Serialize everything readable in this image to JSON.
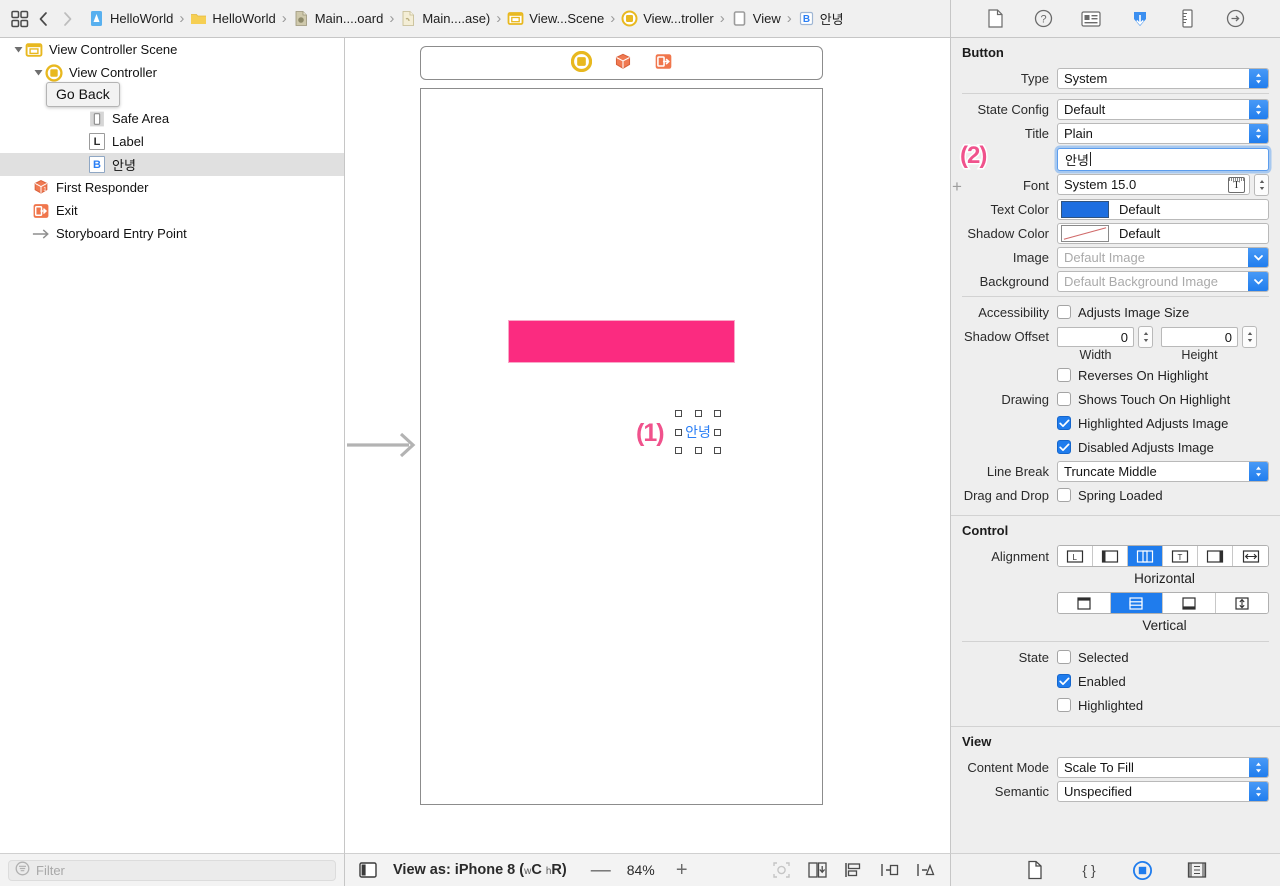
{
  "topbar": {
    "grid_icon": "grid-icon",
    "back_label": "back-chevron",
    "forward_label": "forward-chevron",
    "breadcrumbs": [
      {
        "label": "HelloWorld",
        "icon": "app-project-icon"
      },
      {
        "label": "HelloWorld",
        "icon": "folder-icon"
      },
      {
        "label": "Main....oard",
        "icon": "storyboard-file-icon"
      },
      {
        "label": "Main....ase)",
        "icon": "strings-file-icon"
      },
      {
        "label": "View...Scene",
        "icon": "scene-icon"
      },
      {
        "label": "View...troller",
        "icon": "view-controller-icon"
      },
      {
        "label": "View",
        "icon": "view-icon"
      },
      {
        "label": "안녕",
        "icon": "button-icon"
      }
    ],
    "inspector_tabs": [
      {
        "name": "file-inspector",
        "selected": false
      },
      {
        "name": "quick-help-inspector",
        "selected": false
      },
      {
        "name": "identity-inspector",
        "selected": false
      },
      {
        "name": "attributes-inspector",
        "selected": true
      },
      {
        "name": "size-inspector",
        "selected": false
      },
      {
        "name": "connections-inspector",
        "selected": false
      }
    ]
  },
  "outline": {
    "tooltip": "Go Back",
    "rows": [
      {
        "label": "View Controller Scene",
        "icon": "scene-icon",
        "indent": 0,
        "twisty": "open",
        "selected": false
      },
      {
        "label": "View Controller",
        "icon": "view-controller-icon",
        "indent": 1,
        "twisty": "open",
        "selected": false
      },
      {
        "label": "View",
        "icon": "view-icon",
        "indent": 2,
        "twisty": "open",
        "selected": false
      },
      {
        "label": "Safe Area",
        "icon": "safe-area-icon",
        "indent": 3,
        "twisty": "none",
        "selected": false
      },
      {
        "label": "Label",
        "icon": "label-icon",
        "indent": 3,
        "twisty": "none",
        "selected": false
      },
      {
        "label": "안녕",
        "icon": "button-icon",
        "indent": 3,
        "twisty": "none",
        "selected": true
      },
      {
        "label": "First Responder",
        "icon": "first-responder-icon",
        "indent": 1,
        "twisty": "none",
        "selected": false
      },
      {
        "label": "Exit",
        "icon": "exit-icon",
        "indent": 1,
        "twisty": "none",
        "selected": false
      },
      {
        "label": "Storyboard Entry Point",
        "icon": "entry-point-arrow-icon",
        "indent": 1,
        "twisty": "none",
        "selected": false
      }
    ],
    "filter_placeholder": "Filter"
  },
  "canvas": {
    "dock_icons": [
      "view-controller-icon",
      "first-responder-icon",
      "exit-icon"
    ],
    "label_color": "#fb2b80",
    "selected_button_title": "안녕",
    "annotation_1": "(1)",
    "annotation_2": "(2)",
    "bottom": {
      "view_as": "View as: iPhone 8 (",
      "view_as_wc": "w",
      "view_as_c": "C ",
      "view_as_hr": "h",
      "view_as_r": "R)",
      "minus": "—",
      "zoom": "84%",
      "plus": "+"
    }
  },
  "inspector": {
    "button_section": {
      "title": "Button",
      "type_label": "Type",
      "type_value": "System",
      "state_config_label": "State Config",
      "state_config_value": "Default",
      "title_label": "Title",
      "title_value": "Plain",
      "title_text_value": "안녕",
      "font_label": "Font",
      "font_value": "System 15.0",
      "text_color_label": "Text Color",
      "text_color_value": "Default",
      "text_color_swatch": "#1d6ee0",
      "shadow_color_label": "Shadow Color",
      "shadow_color_value": "Default",
      "image_label": "Image",
      "image_placeholder": "Default Image",
      "background_label": "Background",
      "background_placeholder": "Default Background Image",
      "accessibility_label": "Accessibility",
      "adjusts_image_size": "Adjusts Image Size",
      "adjusts_image_size_checked": false,
      "shadow_offset_label": "Shadow Offset",
      "shadow_width_value": "0",
      "shadow_height_value": "0",
      "width_caption": "Width",
      "height_caption": "Height",
      "drawing_label": "Drawing",
      "drawing_options": [
        {
          "label": "Reverses On Highlight",
          "checked": false
        },
        {
          "label": "Shows Touch On Highlight",
          "checked": false
        },
        {
          "label": "Highlighted Adjusts Image",
          "checked": true
        },
        {
          "label": "Disabled Adjusts Image",
          "checked": true
        }
      ],
      "line_break_label": "Line Break",
      "line_break_value": "Truncate Middle",
      "drag_drop_label": "Drag and Drop",
      "spring_loaded": "Spring Loaded",
      "spring_loaded_checked": false,
      "plus_glyph": "+"
    },
    "control_section": {
      "title": "Control",
      "alignment_label": "Alignment",
      "horizontal_caption": "Horizontal",
      "vertical_caption": "Vertical",
      "horizontal_segments": [
        "align-left",
        "align-leading",
        "align-center",
        "align-trailing",
        "align-right",
        "align-fill-h"
      ],
      "horizontal_selected_index": 2,
      "vertical_segments": [
        "align-top",
        "align-middle",
        "align-bottom",
        "align-fill-v"
      ],
      "vertical_selected_index": 1,
      "state_label": "State",
      "state_options": [
        {
          "label": "Selected",
          "checked": false
        },
        {
          "label": "Enabled",
          "checked": true
        },
        {
          "label": "Highlighted",
          "checked": false
        }
      ]
    },
    "view_section": {
      "title": "View",
      "content_mode_label": "Content Mode",
      "content_mode_value": "Scale To Fill",
      "semantic_label": "Semantic",
      "semantic_value": "Unspecified"
    },
    "bottom_icons": [
      {
        "name": "library-file-icon",
        "selected": false
      },
      {
        "name": "library-code-snippet-icon",
        "selected": false
      },
      {
        "name": "library-object-icon",
        "selected": true
      },
      {
        "name": "library-media-icon",
        "selected": false
      }
    ]
  }
}
